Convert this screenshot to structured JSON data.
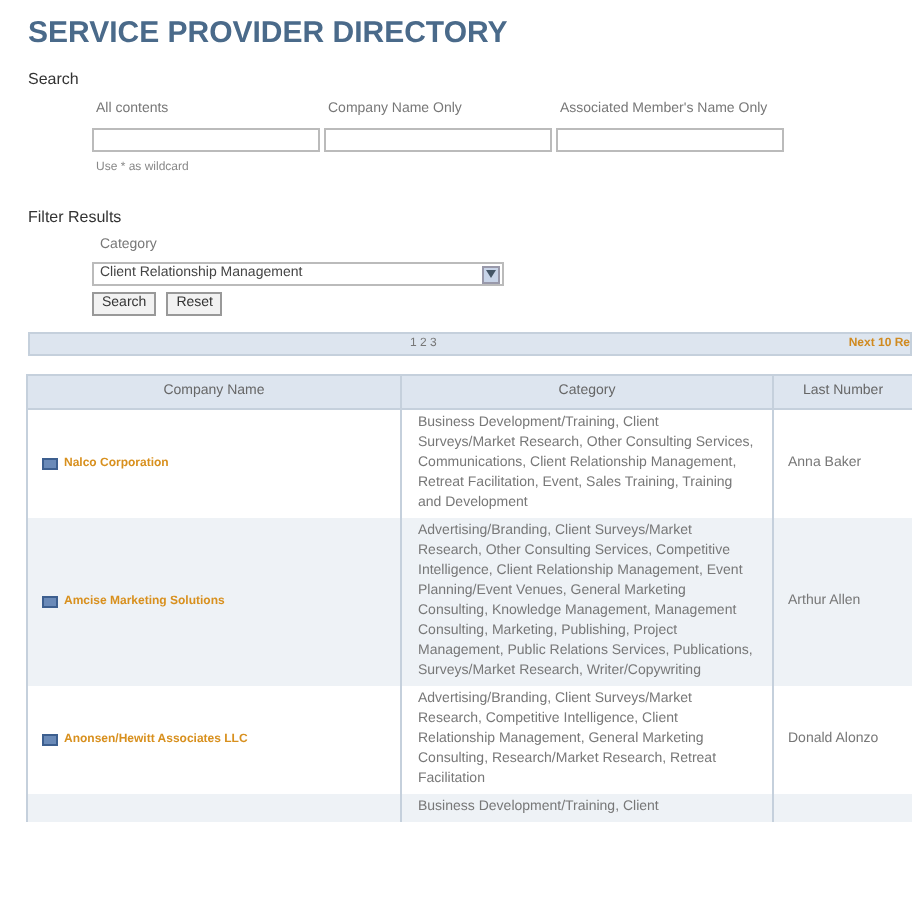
{
  "title": "SERVICE PROVIDER DIRECTORY",
  "search": {
    "heading": "Search",
    "fields": [
      {
        "label": "All contents"
      },
      {
        "label": "Company Name Only"
      },
      {
        "label": "Associated Member's Name Only"
      }
    ],
    "hint": "Use * as wildcard"
  },
  "filter": {
    "heading": "Filter Results",
    "category_label": "Category",
    "category_value": "Client Relationship Management",
    "buttons": [
      "Search",
      "Reset"
    ]
  },
  "pager": {
    "pages": "1 2 3",
    "next": "Next 10 Re"
  },
  "table": {
    "columns": [
      "Company Name",
      "Category",
      "Last Number"
    ],
    "rows": [
      {
        "company": "Nalco Corporation",
        "category": "Business Development/Training, Client Surveys/Market Research, Other Consulting Services, Communications, Client Relationship Management, Retreat Facilitation, Event, Sales Training, Training and Development",
        "contact": "Anna Baker"
      },
      {
        "company": "Amcise Marketing Solutions",
        "category": "Advertising/Branding, Client Surveys/Market Research, Other Consulting Services, Competitive Intelligence, Client Relationship Management, Event Planning/Event Venues, General Marketing Consulting, Knowledge Management, Management Consulting, Marketing, Publishing, Project Management, Public Relations Services, Publications, Surveys/Market Research, Writer/Copywriting",
        "contact": "Arthur Allen"
      },
      {
        "company": "Anonsen/Hewitt Associates LLC",
        "category": "Advertising/Branding, Client Surveys/Market Research, Competitive Intelligence, Client Relationship Management, General Marketing Consulting, Research/Market Research, Retreat Facilitation",
        "contact": "Donald Alonzo"
      },
      {
        "company": "",
        "category": "Business Development/Training, Client",
        "contact": ""
      }
    ]
  }
}
